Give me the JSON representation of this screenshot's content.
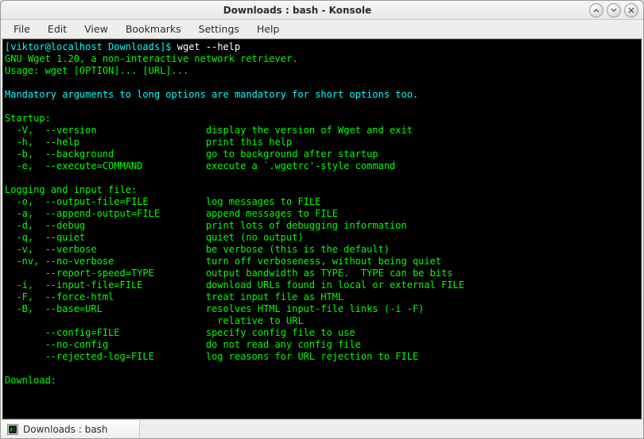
{
  "window": {
    "title": "Downloads : bash - Konsole"
  },
  "menubar": {
    "items": [
      "File",
      "Edit",
      "View",
      "Bookmarks",
      "Settings",
      "Help"
    ]
  },
  "terminal": {
    "prompt": "[viktor@localhost Downloads]$ ",
    "command": "wget --help",
    "line1": "GNU Wget 1.20, a non-interactive network retriever.",
    "line2": "Usage: wget [OPTION]... [URL]...",
    "blank": "",
    "line3": "Mandatory arguments to long options are mandatory for short options too.",
    "section_startup": "Startup:",
    "opt_V": "  -V,  --version                   display the version of Wget and exit",
    "opt_h": "  -h,  --help                      print this help",
    "opt_b": "  -b,  --background                go to background after startup",
    "opt_e": "  -e,  --execute=COMMAND           execute a `.wgetrc'-style command",
    "section_logging": "Logging and input file:",
    "opt_o": "  -o,  --output-file=FILE          log messages to FILE",
    "opt_a": "  -a,  --append-output=FILE        append messages to FILE",
    "opt_d": "  -d,  --debug                     print lots of debugging information",
    "opt_q": "  -q,  --quiet                     quiet (no output)",
    "opt_v": "  -v,  --verbose                   be verbose (this is the default)",
    "opt_nv": "  -nv, --no-verbose                turn off verboseness, without being quiet",
    "opt_rs": "       --report-speed=TYPE         output bandwidth as TYPE.  TYPE can be bits",
    "opt_i": "  -i,  --input-file=FILE           download URLs found in local or external FILE",
    "opt_F": "  -F,  --force-html                treat input file as HTML",
    "opt_B": "  -B,  --base=URL                  resolves HTML input-file links (-i -F)",
    "opt_B2": "                                     relative to URL",
    "opt_cf": "       --config=FILE               specify config file to use",
    "opt_nc": "       --no-config                 do not read any config file",
    "opt_rl": "       --rejected-log=FILE         log reasons for URL rejection to FILE",
    "section_download": "Download:"
  },
  "statusbar": {
    "tab_label": "Downloads : bash"
  }
}
